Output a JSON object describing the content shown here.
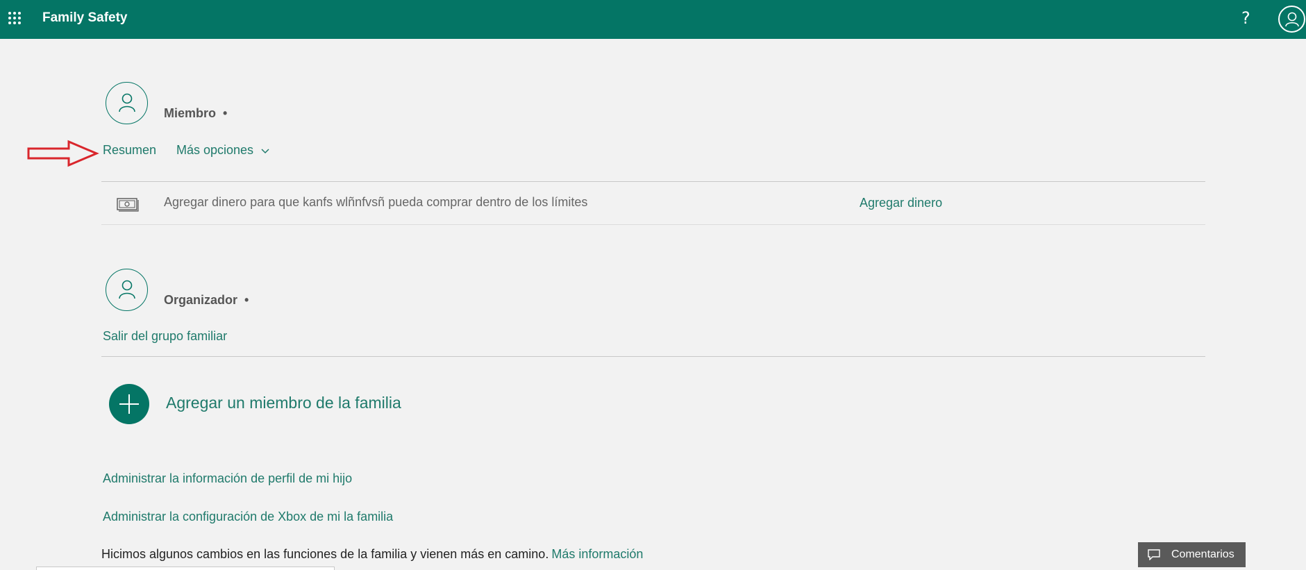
{
  "header": {
    "title": "Family Safety",
    "help_icon": "?",
    "bg_color": "#047565"
  },
  "member": {
    "role_label": "Miembro",
    "dot": "•",
    "tabs": [
      {
        "label": "Resumen"
      },
      {
        "label": "Más opciones"
      }
    ],
    "money_row": {
      "text": "Agregar dinero para que kanfs wlñnfvsñ pueda comprar dentro de los límites",
      "action": "Agregar dinero"
    }
  },
  "organizer": {
    "role_label": "Organizador",
    "dot": "•",
    "leave_link": "Salir del grupo familiar"
  },
  "add_member": {
    "label": "Agregar un miembro de la familia"
  },
  "links": [
    {
      "label": "Administrar la información de perfil de mi hijo"
    },
    {
      "label": "Administrar la configuración de Xbox de mi la familia"
    }
  ],
  "notice": {
    "text": "Hicimos algunos cambios en las funciones de la familia y vienen más en camino.",
    "more_link": "Más información"
  },
  "feedback": {
    "label": "Comentarios"
  },
  "colors": {
    "accent": "#047565",
    "link": "#1f7a6b",
    "annotation_arrow": "#d9262c"
  }
}
